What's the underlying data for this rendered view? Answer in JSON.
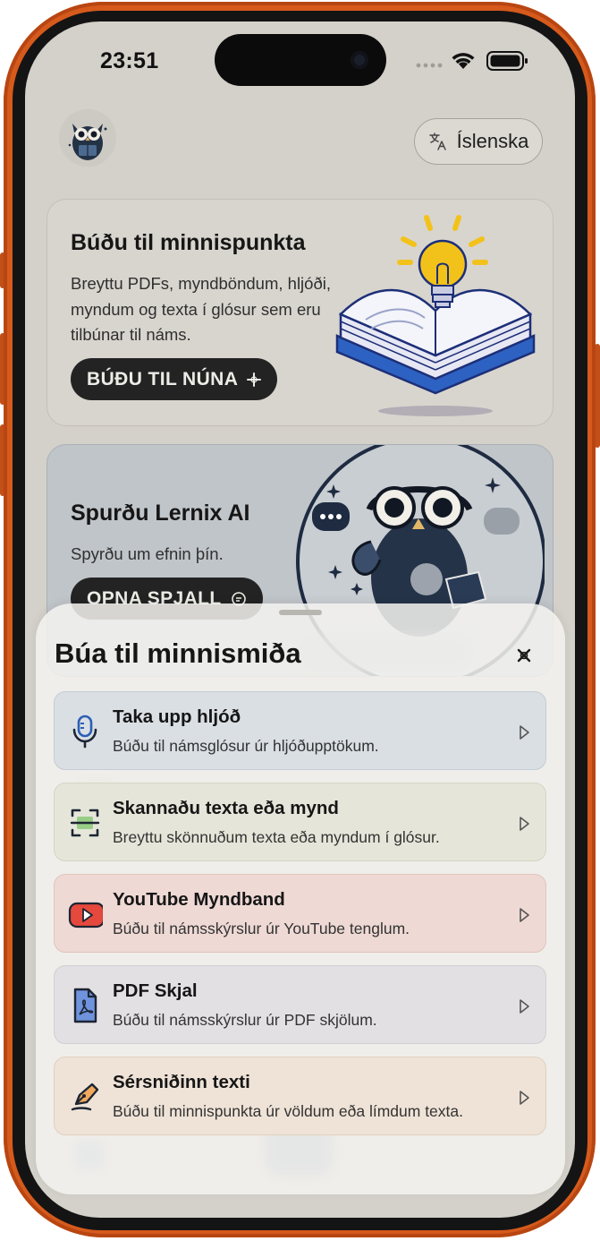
{
  "status_bar": {
    "time": "23:51"
  },
  "header": {
    "language_label": "Íslenska"
  },
  "card_notes": {
    "title": "Búðu til minnispunkta",
    "description": "Breyttu PDFs, myndböndum, hljóði, myndum og texta í glósur sem eru tilbúnar til náms.",
    "button_label": "BÚÐU TIL NÚNA"
  },
  "card_chat": {
    "title": "Spurðu Lernix AI",
    "description": "Spyrðu um efnin þín.",
    "button_label": "OPNA SPJALL"
  },
  "sheet": {
    "title": "Búa til minnismiða",
    "options": [
      {
        "title": "Taka upp hljóð",
        "description": "Búðu til námsglósur úr hljóðupptökum.",
        "icon": "microphone-icon",
        "color": "#dadfe4"
      },
      {
        "title": "Skannaðu texta eða mynd",
        "description": "Breyttu skönnuðum texta eða myndum í glósur.",
        "icon": "scan-icon",
        "color": "#e5e6d9"
      },
      {
        "title": "YouTube Myndband",
        "description": "Búðu til námsskýrslur úr YouTube tenglum.",
        "icon": "youtube-icon",
        "color": "#eed9d4"
      },
      {
        "title": "PDF Skjal",
        "description": "Búðu til námsskýrslur úr PDF skjölum.",
        "icon": "pdf-icon",
        "color": "#e3e0e4"
      },
      {
        "title": "Sérsniðinn texti",
        "description": "Búðu til minnispunkta úr völdum eða límdum texta.",
        "icon": "pen-icon",
        "color": "#efe3d7"
      }
    ]
  },
  "colors": {
    "frame": "#d65a1c",
    "screen_bg": "#d4d1ca",
    "accent_blue": "#2c5fb4",
    "youtube_red": "#e5483c"
  }
}
